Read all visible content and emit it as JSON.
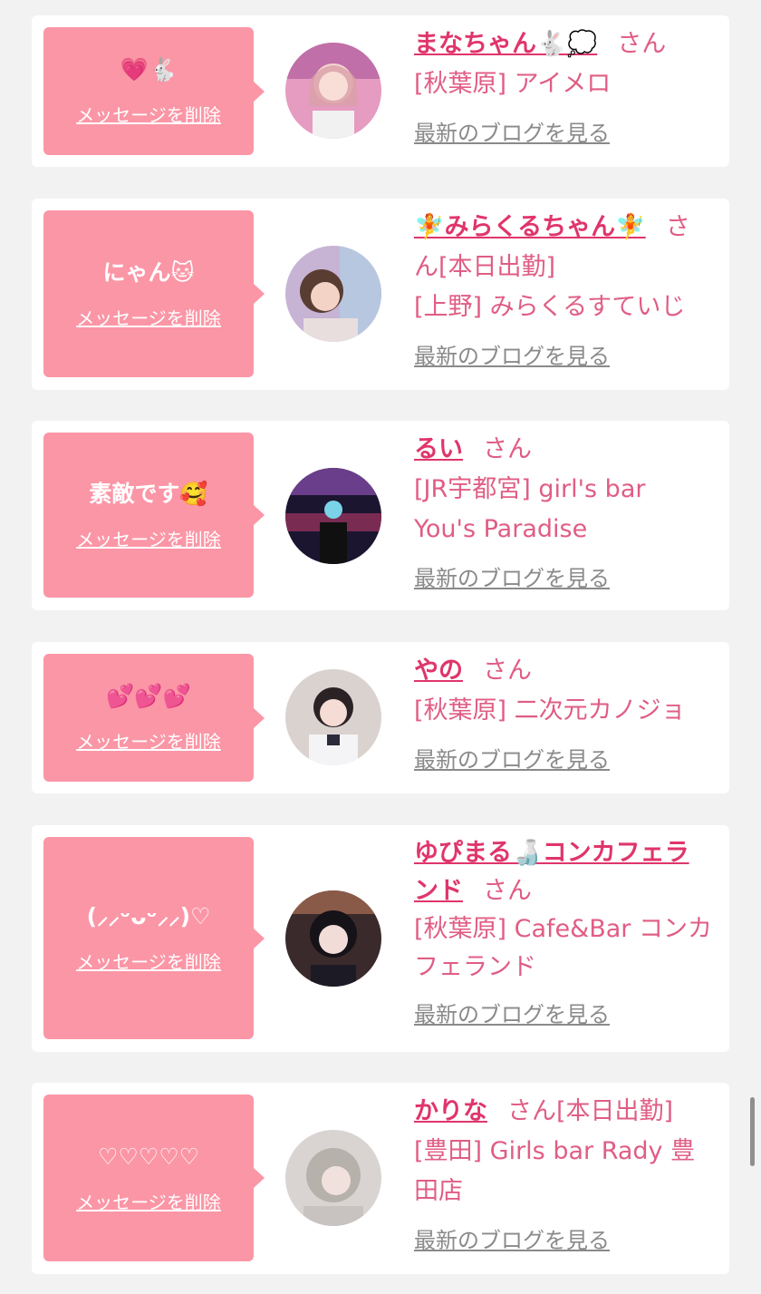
{
  "delete_label": "メッセージを削除",
  "blog_label": "最新のブログを見る",
  "san_label": "さん",
  "theme": {
    "bubble": "#fb96a6",
    "name": "#e0356b",
    "text": "#e05d84",
    "link_gray": "#8a8a8a",
    "bg": "#f2f2f2"
  },
  "cards": [
    {
      "message": "💗🐇",
      "name": "まなちゃん🐇💭",
      "suffix": "さん",
      "shop": "[秋葉原] アイメロ"
    },
    {
      "message": "にゃん🐱",
      "name": "🧚みらくるちゃん🧚",
      "suffix": "さん[本日出勤]",
      "shop": "[上野] みらくるすていじ"
    },
    {
      "message": "素敵です🥰",
      "name": "るい",
      "suffix": "さん",
      "shop": "[JR宇都宮] girl's bar You's Paradise"
    },
    {
      "message": "💕💕💕",
      "name": "やの",
      "suffix": "さん",
      "shop": "[秋葉原] 二次元カノジョ"
    },
    {
      "message": "(⸝⸝ᵕᴗᵕ⸝⸝)♡",
      "name": "ゆぴまる🍶コンカフェランド",
      "suffix": "さん",
      "shop": "[秋葉原] Cafe&Bar コンカフェランド"
    },
    {
      "message": "♡♡♡♡♡",
      "name": "かりな",
      "suffix": "さん[本日出勤]",
      "shop": "[豊田] Girls bar Rady 豊田店"
    }
  ]
}
